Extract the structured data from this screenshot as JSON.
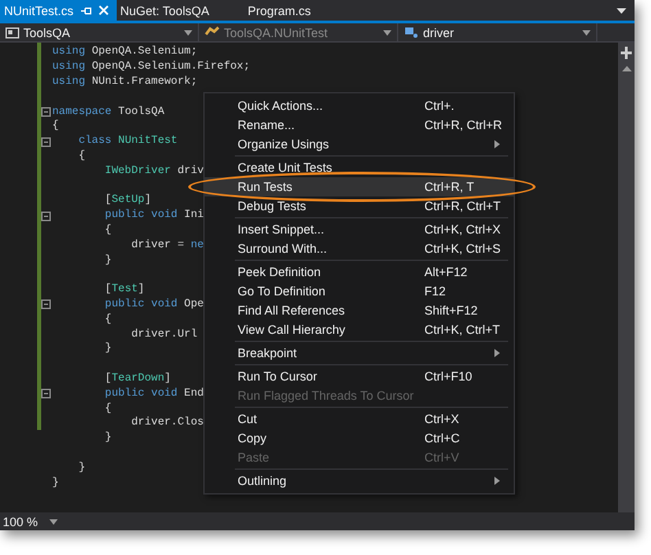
{
  "tabs": [
    {
      "label": "NUnitTest.cs",
      "selected": true,
      "pinnable": true,
      "closable": true
    },
    {
      "label": "NuGet: ToolsQA",
      "selected": false,
      "pinnable": false,
      "closable": false
    },
    {
      "label": "Program.cs",
      "selected": false,
      "pinnable": false,
      "closable": false
    }
  ],
  "nav_bar": [
    {
      "label": "ToolsQA",
      "kind": "project",
      "disabled": false
    },
    {
      "label": "ToolsQA.NUnitTest",
      "kind": "class",
      "disabled": true
    },
    {
      "label": "driver",
      "kind": "field",
      "disabled": false
    }
  ],
  "code_lines": [
    {
      "foldable": false,
      "tokens": [
        {
          "kind": "keyword",
          "text": "using"
        },
        {
          "kind": "plain",
          "text": " OpenQA.Selenium;"
        }
      ]
    },
    {
      "foldable": false,
      "tokens": [
        {
          "kind": "keyword",
          "text": "using"
        },
        {
          "kind": "plain",
          "text": " OpenQA.Selenium.Firefox;"
        }
      ]
    },
    {
      "foldable": false,
      "tokens": [
        {
          "kind": "keyword",
          "text": "using"
        },
        {
          "kind": "plain",
          "text": " NUnit.Framework;"
        }
      ]
    },
    {
      "kind": "blank"
    },
    {
      "foldable": true,
      "tokens": [
        {
          "kind": "keyword",
          "text": "namespace"
        },
        {
          "kind": "plain",
          "text": " ToolsQA"
        }
      ]
    },
    {
      "foldable": false,
      "tokens": [
        {
          "kind": "plain",
          "text": "{"
        }
      ]
    },
    {
      "foldable": true,
      "tokens": [
        {
          "kind": "keyword",
          "text": "    class"
        },
        {
          "kind": "type",
          "text": " NUnitTest"
        }
      ]
    },
    {
      "foldable": false,
      "tokens": [
        {
          "kind": "plain",
          "text": "    {"
        }
      ]
    },
    {
      "foldable": false,
      "tokens": [
        {
          "kind": "type",
          "text": "        IWebDriver"
        },
        {
          "kind": "plain",
          "text": " driv"
        }
      ]
    },
    {
      "kind": "blank"
    },
    {
      "foldable": false,
      "tokens": [
        {
          "kind": "plain",
          "text": "        ["
        },
        {
          "kind": "type",
          "text": "SetUp"
        },
        {
          "kind": "plain",
          "text": "]"
        }
      ]
    },
    {
      "foldable": true,
      "tokens": [
        {
          "kind": "keyword",
          "text": "        public void"
        },
        {
          "kind": "plain",
          "text": " Ini"
        }
      ]
    },
    {
      "foldable": false,
      "tokens": [
        {
          "kind": "plain",
          "text": "        {"
        }
      ]
    },
    {
      "foldable": false,
      "tokens": [
        {
          "kind": "plain",
          "text": "            driver = "
        },
        {
          "kind": "keyword",
          "text": "ne"
        }
      ]
    },
    {
      "foldable": false,
      "tokens": [
        {
          "kind": "plain",
          "text": "        }"
        }
      ]
    },
    {
      "kind": "blank"
    },
    {
      "foldable": false,
      "tokens": [
        {
          "kind": "plain",
          "text": "        ["
        },
        {
          "kind": "type",
          "text": "Test"
        },
        {
          "kind": "plain",
          "text": "]"
        }
      ]
    },
    {
      "foldable": true,
      "tokens": [
        {
          "kind": "keyword",
          "text": "        public void"
        },
        {
          "kind": "plain",
          "text": " Ope"
        }
      ]
    },
    {
      "foldable": false,
      "tokens": [
        {
          "kind": "plain",
          "text": "        {"
        }
      ]
    },
    {
      "foldable": false,
      "tokens": [
        {
          "kind": "plain",
          "text": "            driver.Url"
        }
      ]
    },
    {
      "foldable": false,
      "tokens": [
        {
          "kind": "plain",
          "text": "        }"
        }
      ]
    },
    {
      "kind": "blank"
    },
    {
      "foldable": false,
      "tokens": [
        {
          "kind": "plain",
          "text": "        ["
        },
        {
          "kind": "type",
          "text": "TearDown"
        },
        {
          "kind": "plain",
          "text": "]"
        }
      ]
    },
    {
      "foldable": true,
      "tokens": [
        {
          "kind": "keyword",
          "text": "        public void"
        },
        {
          "kind": "plain",
          "text": " End"
        }
      ]
    },
    {
      "foldable": false,
      "tokens": [
        {
          "kind": "plain",
          "text": "        {"
        }
      ]
    },
    {
      "foldable": false,
      "tokens": [
        {
          "kind": "plain",
          "text": "            driver.Clos"
        }
      ]
    },
    {
      "foldable": false,
      "tokens": [
        {
          "kind": "plain",
          "text": "        }"
        }
      ]
    },
    {
      "kind": "blank"
    },
    {
      "foldable": false,
      "tokens": [
        {
          "kind": "plain",
          "text": "    }"
        }
      ]
    },
    {
      "foldable": false,
      "tokens": [
        {
          "kind": "plain",
          "text": "}"
        }
      ]
    }
  ],
  "context_menu": [
    {
      "kind": "item",
      "label": "Quick Actions...",
      "shortcut": "Ctrl+.",
      "submenu": false,
      "disabled": false,
      "selected": false,
      "circled": false
    },
    {
      "kind": "item",
      "label": "Rename...",
      "shortcut": "Ctrl+R, Ctrl+R",
      "submenu": false,
      "disabled": false,
      "selected": false,
      "circled": false
    },
    {
      "kind": "item",
      "label": "Organize Usings",
      "submenu": true,
      "disabled": false,
      "selected": false,
      "circled": false
    },
    {
      "kind": "separator"
    },
    {
      "kind": "item",
      "label": "Create Unit Tests",
      "submenu": false,
      "disabled": false,
      "selected": false,
      "circled": false
    },
    {
      "kind": "item",
      "label": "Run Tests",
      "shortcut": "Ctrl+R, T",
      "submenu": false,
      "disabled": false,
      "selected": true,
      "circled": true
    },
    {
      "kind": "item",
      "label": "Debug Tests",
      "shortcut": "Ctrl+R, Ctrl+T",
      "submenu": false,
      "disabled": false,
      "selected": false,
      "circled": false
    },
    {
      "kind": "separator"
    },
    {
      "kind": "item",
      "label": "Insert Snippet...",
      "shortcut": "Ctrl+K, Ctrl+X",
      "submenu": false,
      "disabled": false,
      "selected": false,
      "circled": false
    },
    {
      "kind": "item",
      "label": "Surround With...",
      "shortcut": "Ctrl+K, Ctrl+S",
      "submenu": false,
      "disabled": false,
      "selected": false,
      "circled": false
    },
    {
      "kind": "separator"
    },
    {
      "kind": "item",
      "label": "Peek Definition",
      "shortcut": "Alt+F12",
      "submenu": false,
      "disabled": false,
      "selected": false,
      "circled": false
    },
    {
      "kind": "item",
      "label": "Go To Definition",
      "shortcut": "F12",
      "submenu": false,
      "disabled": false,
      "selected": false,
      "circled": false
    },
    {
      "kind": "item",
      "label": "Find All References",
      "shortcut": "Shift+F12",
      "submenu": false,
      "disabled": false,
      "selected": false,
      "circled": false
    },
    {
      "kind": "item",
      "label": "View Call Hierarchy",
      "shortcut": "Ctrl+K, Ctrl+T",
      "submenu": false,
      "disabled": false,
      "selected": false,
      "circled": false
    },
    {
      "kind": "separator"
    },
    {
      "kind": "item",
      "label": "Breakpoint",
      "submenu": true,
      "disabled": false,
      "selected": false,
      "circled": false
    },
    {
      "kind": "separator"
    },
    {
      "kind": "item",
      "label": "Run To Cursor",
      "shortcut": "Ctrl+F10",
      "submenu": false,
      "disabled": false,
      "selected": false,
      "circled": false
    },
    {
      "kind": "item",
      "label": "Run Flagged Threads To Cursor",
      "submenu": false,
      "disabled": true,
      "selected": false,
      "circled": false
    },
    {
      "kind": "separator"
    },
    {
      "kind": "item",
      "label": "Cut",
      "shortcut": "Ctrl+X",
      "submenu": false,
      "disabled": false,
      "selected": false,
      "circled": false
    },
    {
      "kind": "item",
      "label": "Copy",
      "shortcut": "Ctrl+C",
      "submenu": false,
      "disabled": false,
      "selected": false,
      "circled": false
    },
    {
      "kind": "item",
      "label": "Paste",
      "shortcut": "Ctrl+V",
      "submenu": false,
      "disabled": true,
      "selected": false,
      "circled": false
    },
    {
      "kind": "separator"
    },
    {
      "kind": "item",
      "label": "Outlining",
      "submenu": true,
      "disabled": false,
      "selected": false,
      "circled": false
    }
  ],
  "status_bar": {
    "zoom": "100 %"
  }
}
